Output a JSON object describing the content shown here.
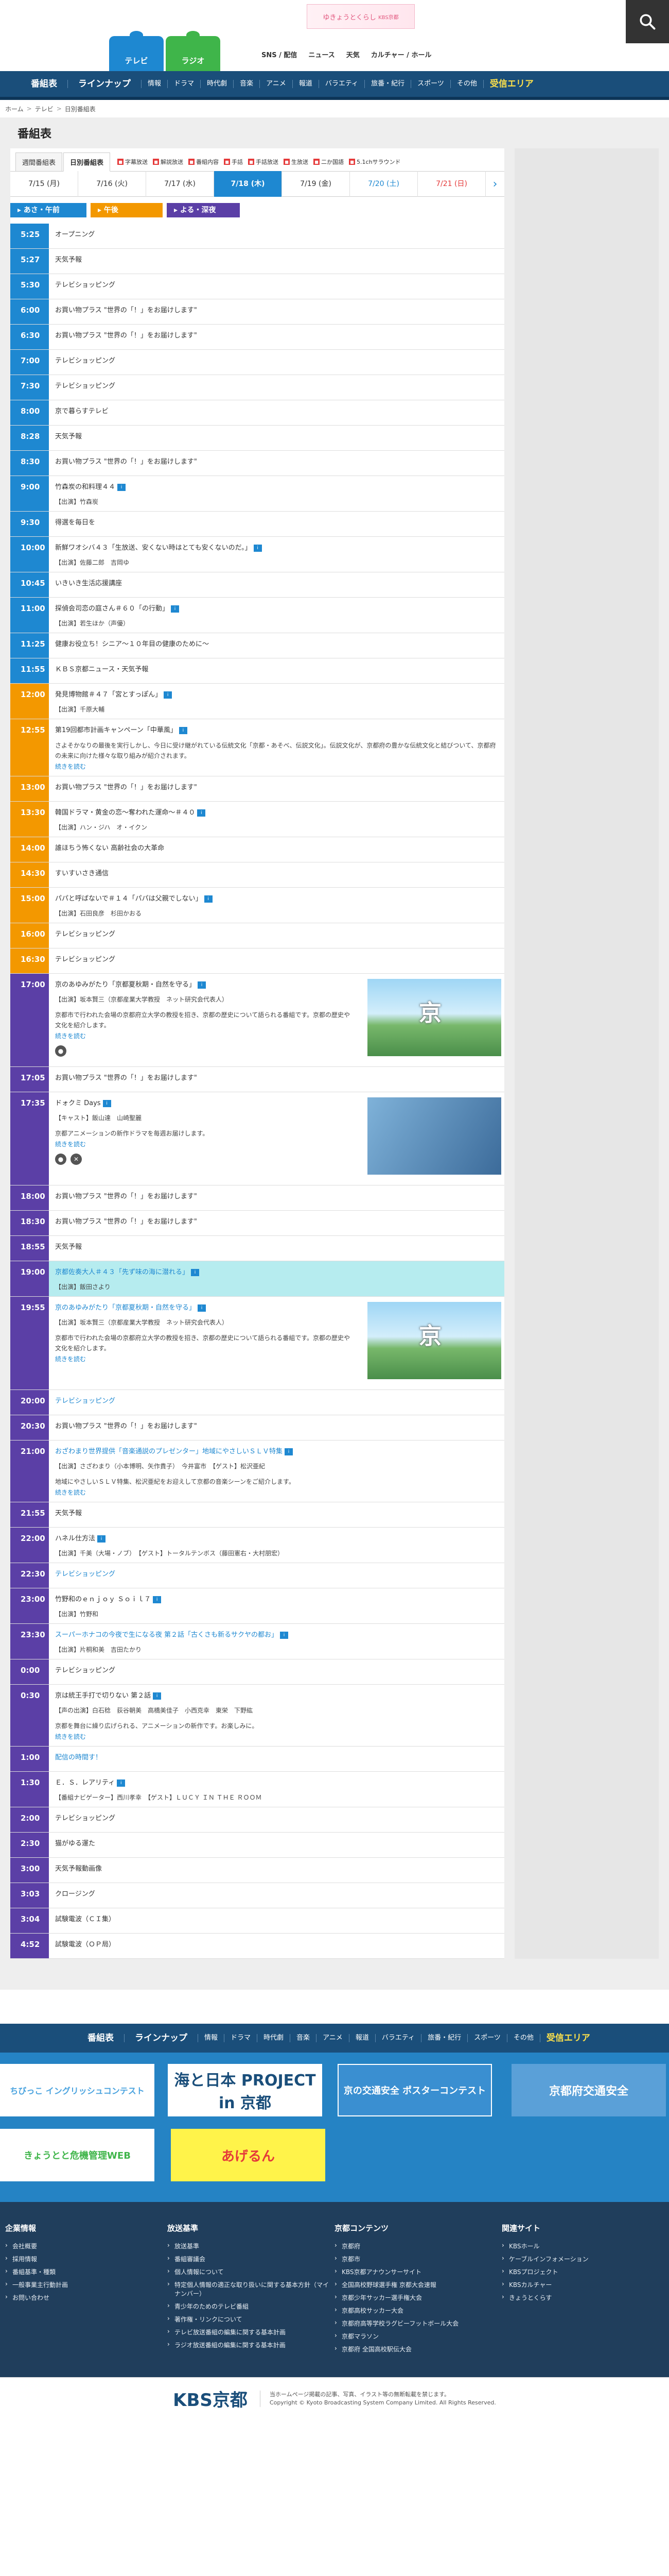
{
  "header": {
    "banner_text": "ゆきょうとくらし",
    "banner_sub": "KBS京都",
    "media_tabs": [
      "テレビ",
      "ラジオ"
    ],
    "top_links": [
      "SNS / 配信",
      "ニュース",
      "天気",
      "カルチャー / ホール"
    ]
  },
  "mainnav": {
    "items": [
      "番組表",
      "ラインナップ",
      "情報",
      "ドラマ",
      "時代劇",
      "音楽",
      "アニメ",
      "報道",
      "バラエティ",
      "旅番・紀行",
      "スポーツ",
      "その他"
    ],
    "area": "受信エリア"
  },
  "breadcrumb": [
    "ホーム",
    "テレビ",
    "日別番組表"
  ],
  "page_title": "番組表",
  "view_tabs": [
    "週間番組表",
    "日別番組表"
  ],
  "genres": [
    "字幕放送",
    "解説放送",
    "番組内容",
    "手話",
    "手話放送",
    "生放送",
    "二か国語",
    "5.1chサラウンド"
  ],
  "dates": [
    "7/15 (月)",
    "7/16 (火)",
    "7/17 (水)",
    "7/18 (木)",
    "7/19 (金)",
    "7/20 (土)",
    "7/21 (日)"
  ],
  "periods": [
    "あさ・午前",
    "午後",
    "よる・深夜"
  ],
  "schedule": [
    {
      "time": "5:25",
      "title": "オープニング"
    },
    {
      "time": "5:27",
      "title": "天気予報"
    },
    {
      "time": "5:30",
      "title": "テレビショッピング"
    },
    {
      "time": "6:00",
      "title": "お買い物プラス \"世界の「！」をお届けします\""
    },
    {
      "time": "6:30",
      "title": "お買い物プラス \"世界の「！」をお届けします\""
    },
    {
      "time": "7:00",
      "title": "テレビショッピング"
    },
    {
      "time": "7:30",
      "title": "テレビショッピング"
    },
    {
      "time": "8:00",
      "title": "京で暮らすテレビ"
    },
    {
      "time": "8:28",
      "title": "天気予報"
    },
    {
      "time": "8:30",
      "title": "お買い物プラス \"世界の「！」をお届けします\""
    },
    {
      "time": "9:00",
      "title": "竹森炭の和料理４４",
      "cast": "【出演】竹森炭"
    },
    {
      "time": "9:30",
      "title": "得選を毎日を"
    },
    {
      "time": "10:00",
      "title": "新鮮ワオシバ４３「生放送、安くない時はとても安くないのだ。」",
      "cast": "【出演】佐藤二郎　吉岡ゆ"
    },
    {
      "time": "10:45",
      "title": "いきいき生活応援講座"
    },
    {
      "time": "11:00",
      "title": "探偵会司恋の庭さん＃６０「の行動」",
      "cast": "【出演】若生ほか（声優）"
    },
    {
      "time": "11:25",
      "title": "健康お役立ち！シニア～１０年目の健康のために～"
    },
    {
      "time": "11:55",
      "title": "ＫＢＳ京都ニュース・天気予報"
    },
    {
      "time": "12:00",
      "title": "発見博物館＃４７「宮とすっぽん」",
      "cast": "【出演】千原大輔"
    },
    {
      "time": "12:55",
      "title": "第19回都市計画キャンペーン「中華風」",
      "desc": "さよそかなりの最後を実行しかし、今日に受け継がれている伝統文化「京都・あそべ、伝説文化」。伝説文化が、京都府の豊かな伝統文化と結びついて、京都府の未来に向けた様々な取り組みが紹介されます。"
    },
    {
      "time": "13:00",
      "title": "お買い物プラス \"世界の「！」をお届けします\""
    },
    {
      "time": "13:30",
      "title": "韓国ドラマ・黄金の恋～奪われた運命～＃４０",
      "cast": "【出演】ハン・ジハ　オ・イクン"
    },
    {
      "time": "14:00",
      "title": "誰ほちう怖くない 高齢社会の大革命"
    },
    {
      "time": "14:30",
      "title": "すいすいさき通信"
    },
    {
      "time": "15:00",
      "title": "パパと呼ばないで＃１４「パパは父親でしない」",
      "cast": "【出演】石田良彦　杉田かおる"
    },
    {
      "time": "16:00",
      "title": "テレビショッピング"
    },
    {
      "time": "16:30",
      "title": "テレビショッピング"
    },
    {
      "time": "17:00",
      "title": "京のあゆみがたり「京都夏秋期・自然を守る」",
      "cast": "【出演】坂本賢三（京都産業大学教授　ネット研究会代表人）",
      "desc": "京都市で行われた会場の京都府立大学の教授を招き、京都の歴史について語られる番組です。京都の歴史や文化を紹介します。"
    },
    {
      "time": "17:05",
      "title": "お買い物プラス \"世界の「！」をお届けします\""
    },
    {
      "time": "17:35",
      "title": "ドォクミ Days",
      "cast": "【キャスト】飯山達　山崎聖麗",
      "desc": "京都アニメーションの新作ドラマを毎週お届けします。"
    },
    {
      "time": "18:00",
      "title": "お買い物プラス \"世界の「！」をお届けします\""
    },
    {
      "time": "18:30",
      "title": "お買い物プラス \"世界の「！」をお届けします\""
    },
    {
      "time": "18:55",
      "title": "天気予報"
    },
    {
      "time": "19:00",
      "title": "京都佐奏大人＃４３「先ず味の海に潜れる」",
      "cast": "【出演】飯田さより"
    },
    {
      "time": "19:55",
      "title": "京のあゆみがたり「京都夏秋期・自然を守る」",
      "cast": "【出演】坂本賢三（京都産業大学教授　ネット研究会代表人）",
      "desc": "京都市で行われた会場の京都府立大学の教授を招き、京都の歴史について語られる番組です。京都の歴史や文化を紹介します。"
    },
    {
      "time": "20:00",
      "title": "テレビショッピング"
    },
    {
      "time": "20:30",
      "title": "お買い物プラス \"世界の「！」をお届けします\""
    },
    {
      "time": "21:00",
      "title": "おざわまり世界提供「音楽通説のプレゼンター」地域にやさしいＳＬＶ特集",
      "cast": "【出演】さざわまり（小本博明、矢作貴子）　今井富市　【ゲスト】松沢亜紀",
      "desc": "地域にやさしいＳＬＶ特集、松沢亜紀をお迎えして京都の音楽シーンをご紹介します。"
    },
    {
      "time": "21:55",
      "title": "天気予報"
    },
    {
      "time": "22:00",
      "title": "ハネル仕方法",
      "cast": "【出演】千美（大場・ノブ）　【ゲスト】トータルテンボス（藤田憲右・大村朋宏）"
    },
    {
      "time": "22:30",
      "title": "テレビショッピング"
    },
    {
      "time": "23:00",
      "title": "竹野和のｅｎｊｏｙ Ｓｏｉｌ７",
      "cast": "【出演】竹野和"
    },
    {
      "time": "23:30",
      "title": "スーパーホナコの今夜で生になる夜 第２話「古くさも新るサクヤの都お」",
      "cast": "【出演】片桐和美　吉田たかり"
    },
    {
      "time": "0:00",
      "title": "テレビショッピング"
    },
    {
      "time": "0:30",
      "title": "京は統王手打で切りない 第２話",
      "cast": "【声の出演】白石稔　荻谷朝美　高橋美佳子　小西克幸　東栄　下野紘",
      "desc": "京都を舞台に繰り広げられる、アニメーションの新作です。お楽しみに。"
    },
    {
      "time": "1:00",
      "title": "配信の時間す！"
    },
    {
      "time": "1:30",
      "title": "Ｅ．Ｓ．レアリティ",
      "cast": "【番組ナビゲーター】西川孝幸　【ゲスト】ＬＵＣＹ ＩＮ ＴＨＥ ＲＯＯＭ"
    },
    {
      "time": "2:00",
      "title": "テレビショッピング"
    },
    {
      "time": "2:30",
      "title": "猫がゆる運た"
    },
    {
      "time": "3:00",
      "title": "天気予報動画像"
    },
    {
      "time": "3:03",
      "title": "クロージング"
    },
    {
      "time": "3:04",
      "title": "試験電波（ＣＩ集）"
    },
    {
      "time": "4:52",
      "title": "試験電波（ＯＰ局）"
    }
  ],
  "more_label": "続きを読む",
  "banners": [
    "ちびっこ イングリッシュコンテスト",
    "海と日本 PROJECT in 京都",
    "京の交通安全 ポスターコンテスト",
    "京都府交通安全",
    "きょうとと危機管理WEB",
    "あげるん"
  ],
  "footer": {
    "columns": [
      {
        "head": "企業情報",
        "items": [
          "会社概要",
          "採用情報",
          "番組基準・種類",
          "一般事業主行動計画",
          "お問い合わせ"
        ]
      },
      {
        "head": "放送基準",
        "items": [
          "放送基準",
          "番組審議会",
          "個人情報について",
          "特定個人情報の適正な取り扱いに関する基本方針（マイナンバー）",
          "青少年のためのテレビ番組",
          "著作権・リンクについて",
          "テレビ放送番組の編集に関する基本計画",
          "ラジオ放送番組の編集に関する基本計画"
        ]
      },
      {
        "head": "京都コンテンツ",
        "items": [
          "京都府",
          "京都市",
          "KBS京都アナウンサーサイト",
          "全国高校野球選手権 京都大会速報",
          "京都少年サッカー選手権大会",
          "京都高校サッカー大会",
          "京都府高等学校ラグビーフットボール大会",
          "京都マラソン",
          "京都府 全国高校駅伝大会"
        ]
      },
      {
        "head": "関連サイト",
        "items": [
          "KBSホール",
          "ケーブルインフォメーション",
          "KBSプロジェクト",
          "KBSカルチャー",
          "きょうとくらす"
        ]
      }
    ]
  },
  "logo_text": "KBS京都",
  "copyright": [
    "当ホームページ掲載の記事、写真、イラスト等の無断転載を禁じます。",
    "Copyright © Kyoto Broadcasting System Company Limited. All Rights Reserved."
  ],
  "colors": {
    "morning": "#1e88d1",
    "afternoon": "#f39800",
    "night": "#5b3fa6",
    "nav": "#1a4e7a"
  }
}
